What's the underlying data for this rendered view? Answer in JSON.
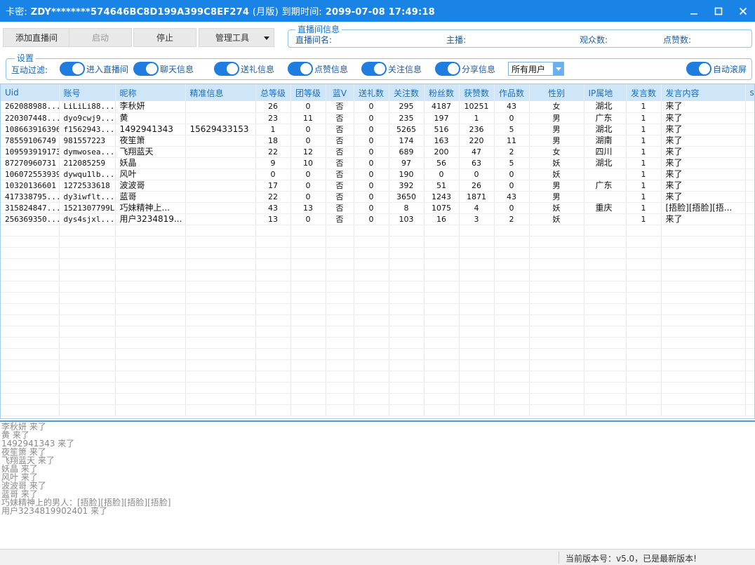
{
  "window": {
    "card_label": "卡密:",
    "card_key": "ZDY********574646BC8D199A399C8EF274",
    "edition": "(月版)",
    "expire_label": "到期时间:",
    "expire_time": "2099-07-08 17:49:18"
  },
  "toolbar": {
    "add_room": "添加直播间",
    "start": "启动",
    "stop": "停止",
    "manage_tools": "管理工具"
  },
  "room_info": {
    "legend": "直播间信息",
    "room_name": "直播间名:",
    "host": "主播:",
    "viewers": "观众数:",
    "likes": "点赞数:"
  },
  "settings": {
    "legend": "设置",
    "filter_label": "互动过滤:",
    "toggles": [
      {
        "label": "进入直播间",
        "on": true
      },
      {
        "label": "聊天信息",
        "on": true
      },
      {
        "label": "送礼信息",
        "on": true
      },
      {
        "label": "点赞信息",
        "on": true
      },
      {
        "label": "关注信息",
        "on": true
      },
      {
        "label": "分享信息",
        "on": true
      }
    ],
    "user_select": "所有用户",
    "auto_scroll": "自动滚屏"
  },
  "table": {
    "headers": [
      "Uid",
      "账号",
      "昵称",
      "精准信息",
      "总等级",
      "团等级",
      "蓝V",
      "送礼数",
      "关注数",
      "粉丝数",
      "获赞数",
      "作品数",
      "性别",
      "IP属地",
      "发言数",
      "发言内容",
      "sei"
    ],
    "rows": [
      [
        "262088988...",
        "LiLiLi88...",
        "李秋妍",
        "",
        "26",
        "0",
        "否",
        "0",
        "295",
        "4187",
        "10251",
        "43",
        "女",
        "湖北",
        "1",
        "来了"
      ],
      [
        "220307448...",
        "dyo9cwj9...",
        "黄",
        "",
        "23",
        "11",
        "否",
        "0",
        "235",
        "197",
        "1",
        "0",
        "男",
        "广东",
        "1",
        "来了"
      ],
      [
        "108663916396",
        "f1562943...",
        "1492941343",
        "15629433153",
        "1",
        "0",
        "否",
        "0",
        "5265",
        "516",
        "236",
        "5",
        "男",
        "湖北",
        "1",
        "来了"
      ],
      [
        "78559106749",
        "981557223",
        "夜笙箫",
        "",
        "18",
        "0",
        "否",
        "0",
        "174",
        "163",
        "220",
        "11",
        "男",
        "湖南",
        "1",
        "来了"
      ],
      [
        "109593919173",
        "dymwosea...",
        "飞翔蓝天",
        "",
        "22",
        "12",
        "否",
        "0",
        "689",
        "200",
        "47",
        "2",
        "女",
        "四川",
        "1",
        "来了"
      ],
      [
        "87270960731",
        "212085259",
        "妖晶",
        "",
        "9",
        "10",
        "否",
        "0",
        "97",
        "56",
        "63",
        "5",
        "妖",
        "湖北",
        "1",
        "来了"
      ],
      [
        "106072553939",
        "dywqu1lb...",
        "风叶",
        "",
        "0",
        "0",
        "否",
        "0",
        "190",
        "0",
        "0",
        "0",
        "妖",
        "",
        "1",
        "来了"
      ],
      [
        "10320136601",
        "1272533618",
        "波波哥",
        "",
        "17",
        "0",
        "否",
        "0",
        "392",
        "51",
        "26",
        "0",
        "男",
        "广东",
        "1",
        "来了"
      ],
      [
        "417338795...",
        "dy3iwflt...",
        "蓝哥",
        "",
        "22",
        "0",
        "否",
        "0",
        "3650",
        "1243",
        "1871",
        "43",
        "男",
        "",
        "1",
        "来了"
      ],
      [
        "315824847...",
        "1521307799L",
        "巧妹精神上...",
        "",
        "43",
        "13",
        "否",
        "0",
        "8",
        "1075",
        "4",
        "0",
        "妖",
        "重庆",
        "1",
        "[捂脸][捂脸][捂..."
      ],
      [
        "256369350...",
        "dys4sjxl...",
        "用户3234819...",
        "",
        "13",
        "0",
        "否",
        "0",
        "103",
        "16",
        "3",
        "2",
        "妖",
        "",
        "1",
        "来了"
      ]
    ]
  },
  "log": [
    "李秋妍 来了",
    "黄 来了",
    "1492941343 来了",
    "夜笙箫 来了",
    "飞翔蓝天 来了",
    "妖晶 来了",
    "风叶 来了",
    "波波哥 来了",
    "蓝哥 来了",
    "巧妹精神上的男人：[捂脸][捂脸][捂脸][捂脸]",
    "用户3234819902401 来了"
  ],
  "status": {
    "version": "当前版本号：v5.0，已是最新版本!"
  },
  "colors": {
    "titlebar": "#1a84e6",
    "accent": "#1f7de0",
    "header_bg": "#cfe6f8"
  }
}
